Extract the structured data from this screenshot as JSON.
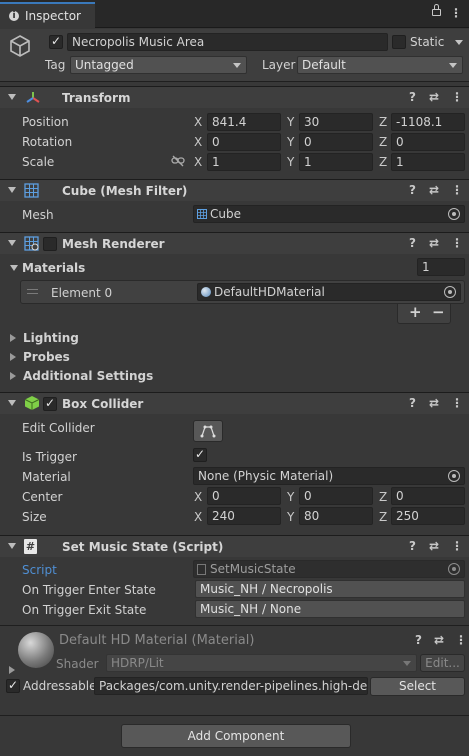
{
  "window": {
    "tab_label": "Inspector"
  },
  "gameobject": {
    "name": "Necropolis Music Area",
    "static_label": "Static",
    "tag_label": "Tag",
    "tag_value": "Untagged",
    "layer_label": "Layer",
    "layer_value": "Default"
  },
  "transform": {
    "title": "Transform",
    "position_label": "Position",
    "rotation_label": "Rotation",
    "scale_label": "Scale",
    "position": {
      "x": "841.4",
      "y": "30",
      "z": "-1108.1"
    },
    "rotation": {
      "x": "0",
      "y": "0",
      "z": "0"
    },
    "scale": {
      "x": "1",
      "y": "1",
      "z": "1"
    }
  },
  "axes": {
    "x": "X",
    "y": "Y",
    "z": "Z"
  },
  "mesh_filter": {
    "title": "Cube (Mesh Filter)",
    "mesh_label": "Mesh",
    "mesh_value": "Cube"
  },
  "mesh_renderer": {
    "title": "Mesh Renderer",
    "materials_label": "Materials",
    "materials_count": "1",
    "element_label": "Element 0",
    "element_value": "DefaultHDMaterial",
    "plus": "+",
    "minus": "−",
    "lighting_label": "Lighting",
    "probes_label": "Probes",
    "additional_label": "Additional Settings"
  },
  "box_collider": {
    "title": "Box Collider",
    "edit_collider_label": "Edit Collider",
    "is_trigger_label": "Is Trigger",
    "material_label": "Material",
    "material_value": "None (Physic Material)",
    "center_label": "Center",
    "size_label": "Size",
    "center": {
      "x": "0",
      "y": "0",
      "z": "0"
    },
    "size": {
      "x": "240",
      "y": "80",
      "z": "250"
    }
  },
  "script_comp": {
    "title": "Set Music State (Script)",
    "script_label": "Script",
    "script_value": "SetMusicState",
    "enter_label": "On Trigger Enter State",
    "enter_value": "Music_NH / Necropolis",
    "exit_label": "On Trigger Exit State",
    "exit_value": "Music_NH / None"
  },
  "material_asset": {
    "title": "Default HD Material (Material)",
    "shader_label": "Shader",
    "shader_value": "HDRP/Lit",
    "edit_label": "Edit...",
    "addressable_label": "Addressable",
    "address_value": "Packages/com.unity.render-pipelines.high-defini",
    "select_label": "Select"
  },
  "footer": {
    "add_component_label": "Add Component"
  },
  "colors": {
    "script_link": "#4f8fd4",
    "background": "#383838",
    "header": "#3e3e3e"
  },
  "icons": [
    "info-icon",
    "lock-icon",
    "kebab-icon",
    "gameobject-cube-icon",
    "transform-icon",
    "mesh-filter-icon",
    "mesh-renderer-icon",
    "box-collider-icon",
    "script-icon",
    "help-icon",
    "presets-icon",
    "chain-link-icon",
    "object-picker-icon",
    "edit-collider-icon",
    "material-sphere-icon"
  ]
}
